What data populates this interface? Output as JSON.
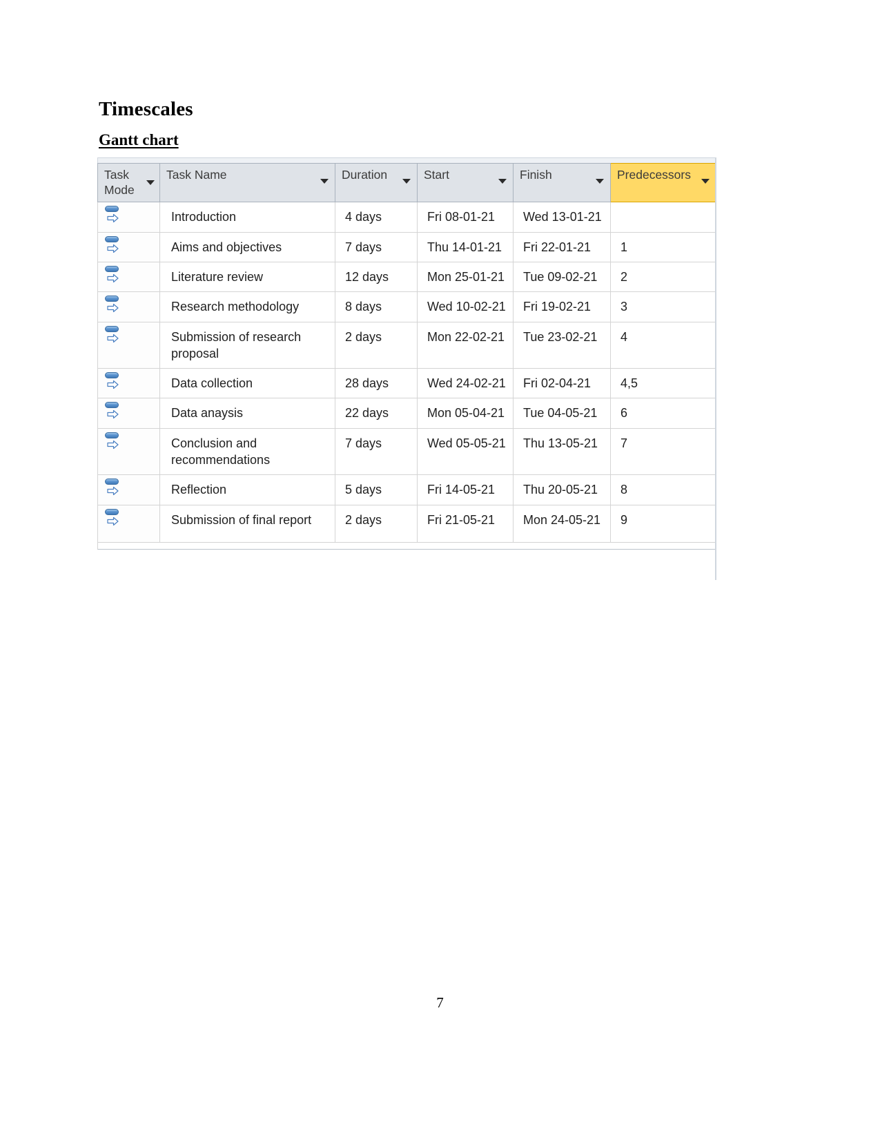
{
  "document": {
    "heading": "Timescales",
    "subheading": "Gantt chart",
    "page_number": "7"
  },
  "gantt_table": {
    "columns": [
      {
        "key": "task_mode",
        "label": "Task Mode",
        "highlighted": false
      },
      {
        "key": "task_name",
        "label": "Task Name",
        "highlighted": false
      },
      {
        "key": "duration",
        "label": "Duration",
        "highlighted": false
      },
      {
        "key": "start",
        "label": "Start",
        "highlighted": false
      },
      {
        "key": "finish",
        "label": "Finish",
        "highlighted": false
      },
      {
        "key": "predecessors",
        "label": "Predecessors",
        "highlighted": true
      }
    ],
    "header_highlight_color": "#ffd966",
    "header_background_color": "#dfe3e8",
    "task_mode_icon": "auto-scheduled-icon",
    "rows": [
      {
        "task_name": "Introduction",
        "duration": "4 days",
        "start": "Fri 08-01-21",
        "finish": "Wed 13-01-21",
        "predecessors": ""
      },
      {
        "task_name": "Aims and objectives",
        "duration": "7 days",
        "start": "Thu 14-01-21",
        "finish": "Fri 22-01-21",
        "predecessors": "1"
      },
      {
        "task_name": "Literature review",
        "duration": "12 days",
        "start": "Mon 25-01-21",
        "finish": "Tue 09-02-21",
        "predecessors": "2"
      },
      {
        "task_name": "Research methodology",
        "duration": "8 days",
        "start": "Wed 10-02-21",
        "finish": "Fri 19-02-21",
        "predecessors": "3"
      },
      {
        "task_name": "Submission of research proposal",
        "duration": "2 days",
        "start": "Mon 22-02-21",
        "finish": "Tue 23-02-21",
        "predecessors": "4"
      },
      {
        "task_name": "Data collection",
        "duration": "28 days",
        "start": "Wed 24-02-21",
        "finish": "Fri 02-04-21",
        "predecessors": "4,5"
      },
      {
        "task_name": "Data anaysis",
        "duration": "22 days",
        "start": "Mon 05-04-21",
        "finish": "Tue 04-05-21",
        "predecessors": "6"
      },
      {
        "task_name": "Conclusion and recommendations",
        "duration": "7 days",
        "start": "Wed 05-05-21",
        "finish": "Thu 13-05-21",
        "predecessors": "7"
      },
      {
        "task_name": "Reflection",
        "duration": "5 days",
        "start": "Fri 14-05-21",
        "finish": "Thu 20-05-21",
        "predecessors": "8"
      },
      {
        "task_name": "Submission of final report",
        "duration": "2 days",
        "start": "Fri 21-05-21",
        "finish": "Mon 24-05-21",
        "predecessors": "9"
      }
    ]
  }
}
